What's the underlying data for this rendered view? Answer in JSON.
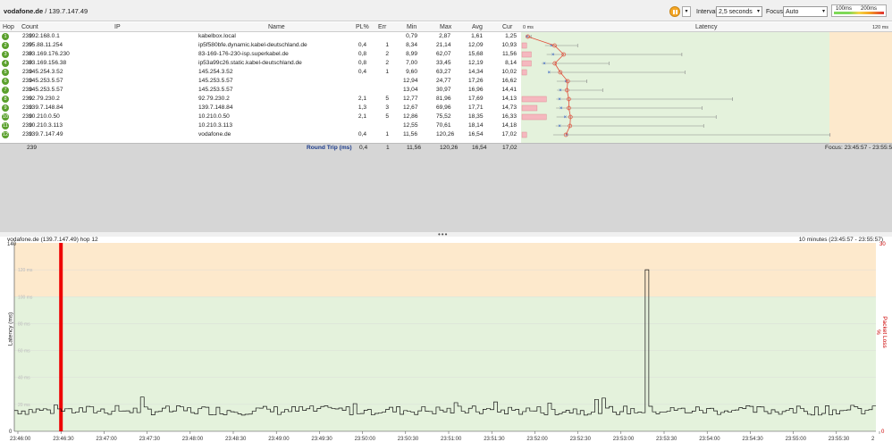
{
  "topbar": {
    "host": "vodafone.de",
    "ip": " / 139.7.147.49",
    "interval_label": "Interval",
    "interval_value": "2,5 seconds",
    "focus_label": "Focus",
    "focus_value": "Auto",
    "scale_100": "100ms",
    "scale_200": "200ms"
  },
  "table": {
    "headers": {
      "hop": "Hop",
      "count": "Count",
      "ip": "IP",
      "name": "Name",
      "pl": "PL%",
      "err": "Err",
      "min": "Min",
      "max": "Max",
      "avg": "Avg",
      "cur": "Cur",
      "zero": "0 ms",
      "latency": "Latency",
      "max_ms": "120 ms"
    },
    "rows": [
      {
        "hop": "1",
        "count": "239",
        "ip": "192.168.0.1",
        "name": "kabelbox.local",
        "pl": "",
        "err": "",
        "min": "0,79",
        "max": "2,87",
        "avg": "1,61",
        "cur": "1,25"
      },
      {
        "hop": "2",
        "count": "239",
        "ip": "95.88.11.254",
        "name": "ip5f580bfe.dynamic.kabel-deutschland.de",
        "pl": "0,4",
        "err": "1",
        "min": "8,34",
        "max": "21,14",
        "avg": "12,09",
        "cur": "10,93"
      },
      {
        "hop": "3",
        "count": "239",
        "ip": "83.169.176.230",
        "name": "83-169-176-230-isp.superkabel.de",
        "pl": "0,8",
        "err": "2",
        "min": "8,99",
        "max": "62,07",
        "avg": "15,68",
        "cur": "11,56"
      },
      {
        "hop": "4",
        "count": "239",
        "ip": "83.169.156.38",
        "name": "ip53a99c26.static.kabel-deutschland.de",
        "pl": "0,8",
        "err": "2",
        "min": "7,00",
        "max": "33,45",
        "avg": "12,19",
        "cur": "8,14"
      },
      {
        "hop": "5",
        "count": "239",
        "ip": "145.254.3.52",
        "name": "145.254.3.52",
        "pl": "0,4",
        "err": "1",
        "min": "9,60",
        "max": "63,27",
        "avg": "14,34",
        "cur": "10,02"
      },
      {
        "hop": "6",
        "count": "239",
        "ip": "145.253.5.57",
        "name": "145.253.5.57",
        "pl": "",
        "err": "",
        "min": "12,94",
        "max": "24,77",
        "avg": "17,26",
        "cur": "16,62"
      },
      {
        "hop": "7",
        "count": "239",
        "ip": "145.253.5.57",
        "name": "145.253.5.57",
        "pl": "",
        "err": "",
        "min": "13,04",
        "max": "30,97",
        "avg": "16,96",
        "cur": "14,41"
      },
      {
        "hop": "8",
        "count": "239",
        "ip": "92.79.230.2",
        "name": "92.79.230.2",
        "pl": "2,1",
        "err": "5",
        "min": "12,77",
        "max": "81,96",
        "avg": "17,69",
        "cur": "14,13"
      },
      {
        "hop": "9",
        "count": "239",
        "ip": "139.7.148.84",
        "name": "139.7.148.84",
        "pl": "1,3",
        "err": "3",
        "min": "12,67",
        "max": "69,96",
        "avg": "17,71",
        "cur": "14,73"
      },
      {
        "hop": "10",
        "count": "239",
        "ip": "10.210.0.50",
        "name": "10.210.0.50",
        "pl": "2,1",
        "err": "5",
        "min": "12,86",
        "max": "75,52",
        "avg": "18,35",
        "cur": "16,33"
      },
      {
        "hop": "11",
        "count": "239",
        "ip": "10.210.3.113",
        "name": "10.210.3.113",
        "pl": "",
        "err": "",
        "min": "12,55",
        "max": "70,61",
        "avg": "18,14",
        "cur": "14,18"
      },
      {
        "hop": "12",
        "count": "239",
        "ip": "139.7.147.49",
        "name": "vodafone.de",
        "pl": "0,4",
        "err": "1",
        "min": "11,56",
        "max": "120,26",
        "avg": "16,54",
        "cur": "17,02"
      }
    ],
    "summary": {
      "count": "239",
      "label": "Round Trip (ms)",
      "pl": "0,4",
      "err": "1",
      "min": "11,56",
      "max": "120,26",
      "avg": "16,54",
      "cur": "17,02",
      "focus": "Focus: 23:45:57 - 23:55:57"
    }
  },
  "chart": {
    "title": "vodafone.de (139.7.147.49) hop 12",
    "range": "10 minutes (23:45:57 - 23:55:57)",
    "ylabel": "Latency (ms)",
    "y2label": "Packet Loss %",
    "y_top": "140",
    "y_zero": "0",
    "y2_top": "30",
    "y2_zero": "0",
    "gridlabels": [
      "120 ms",
      "100 ms",
      "80 ms",
      "60 ms",
      "40 ms",
      "20 ms"
    ],
    "xticks": [
      "23:46:00",
      "23:46:30",
      "23:47:00",
      "23:47:30",
      "23:48:00",
      "23:48:30",
      "23:49:00",
      "23:49:30",
      "23:50:00",
      "23:50:30",
      "23:51:00",
      "23:51:30",
      "23:52:00",
      "23:52:30",
      "23:53:00",
      "23:53:30",
      "23:54:00",
      "23:54:30",
      "23:55:00",
      "23:55:30",
      "2"
    ]
  },
  "chart_data": {
    "type": "line",
    "title": "vodafone.de (139.7.147.49) hop 12",
    "xlabel": "",
    "ylabel": "Latency (ms)",
    "ylim": [
      0,
      140
    ],
    "y2lim": [
      0,
      30
    ],
    "packet_loss_at": "23:46:30",
    "spike": {
      "time": "23:53:10",
      "value": 120
    },
    "typical_range": [
      12,
      22
    ]
  }
}
